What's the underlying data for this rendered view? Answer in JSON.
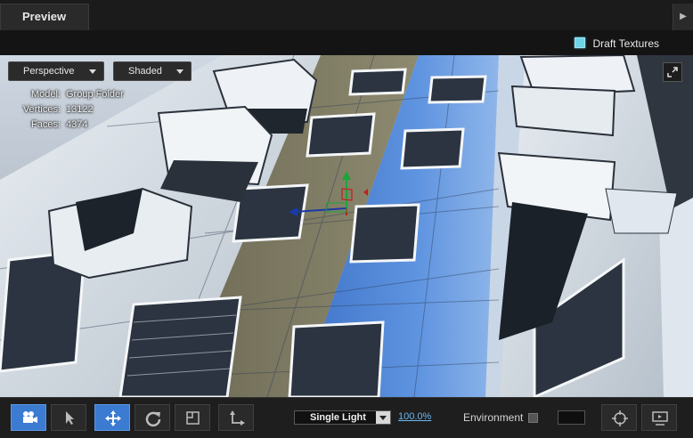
{
  "panel": {
    "title": "Preview",
    "collapse_icon": "triangle-right-icon"
  },
  "options": {
    "draft_textures_label": "Draft Textures",
    "draft_textures_checked": true,
    "accent_color": "#6fd3e8"
  },
  "viewport": {
    "camera_mode": "Perspective",
    "shading_mode": "Shaded",
    "stats": [
      {
        "key": "Model:",
        "value": "Group Folder"
      },
      {
        "key": "Vertices:",
        "value": "13122"
      },
      {
        "key": "Faces:",
        "value": "4374"
      }
    ],
    "expand_icon": "expand-icon",
    "gizmo": "move-gizmo"
  },
  "toolbar": {
    "tools": [
      {
        "name": "camera-icon",
        "active": true
      },
      {
        "name": "select-arrow-icon",
        "active": false
      },
      {
        "name": "move-icon",
        "active": true
      },
      {
        "name": "rotate-icon",
        "active": false
      },
      {
        "name": "frame-icon",
        "active": false
      },
      {
        "name": "scale-axis-icon",
        "active": false
      }
    ],
    "light_mode": "Single Light",
    "zoom": "100.0%",
    "environment_label": "Environment",
    "environment_checked": false,
    "right_icons": [
      "crosshair-icon",
      "display-icon"
    ],
    "active_color": "#3b7bd1"
  }
}
